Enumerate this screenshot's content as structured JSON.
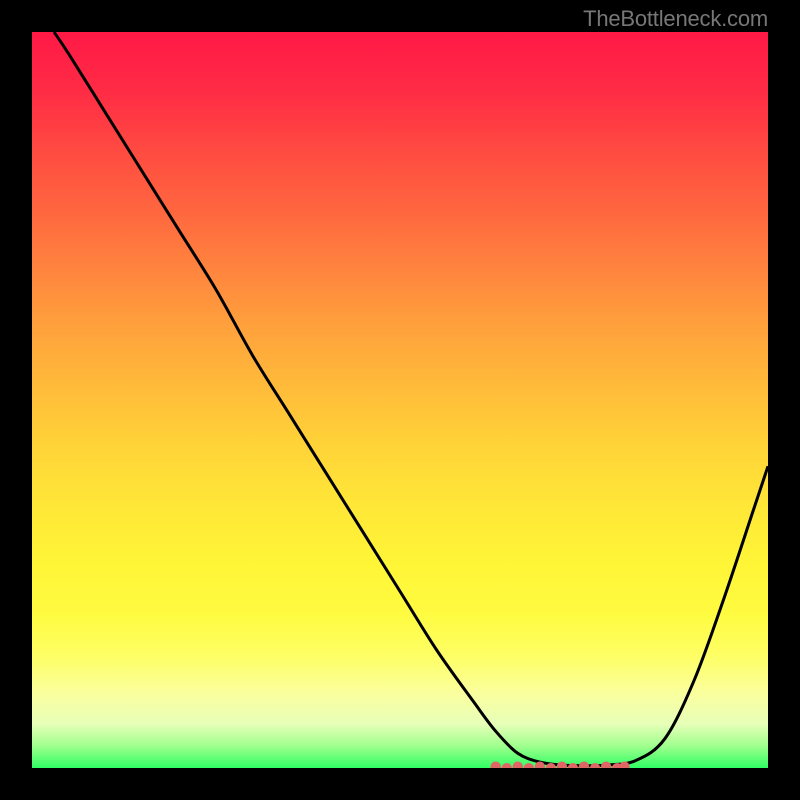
{
  "watermark": "TheBottleneck.com",
  "colors": {
    "bg": "#000000",
    "curve": "#000000",
    "bottom_marker": "#e06666",
    "gradient_top": "#ff1946",
    "gradient_bottom": "#2fff62"
  },
  "chart_data": {
    "type": "line",
    "title": "",
    "xlabel": "",
    "ylabel": "",
    "xlim": [
      0,
      100
    ],
    "ylim": [
      0,
      100
    ],
    "series": [
      {
        "name": "bottleneck-curve",
        "x": [
          3,
          5,
          10,
          15,
          20,
          25,
          30,
          35,
          40,
          45,
          50,
          55,
          60,
          63,
          66,
          69,
          72,
          75,
          78,
          82,
          86,
          90,
          94,
          98,
          100
        ],
        "values": [
          100,
          97,
          89,
          81,
          73,
          65,
          56,
          48,
          40,
          32,
          24,
          16,
          9,
          5,
          2,
          0.8,
          0.4,
          0.3,
          0.4,
          1,
          4,
          12,
          23,
          35,
          41
        ]
      }
    ],
    "annotations": [
      {
        "name": "low-bottleneck-marker",
        "type": "dotted-segment",
        "x_points": [
          63,
          64.5,
          66,
          67.5,
          69,
          70.5,
          72,
          73.5,
          75,
          76.5,
          78,
          79.5,
          80.5
        ],
        "y_value_approx": 1
      }
    ]
  }
}
